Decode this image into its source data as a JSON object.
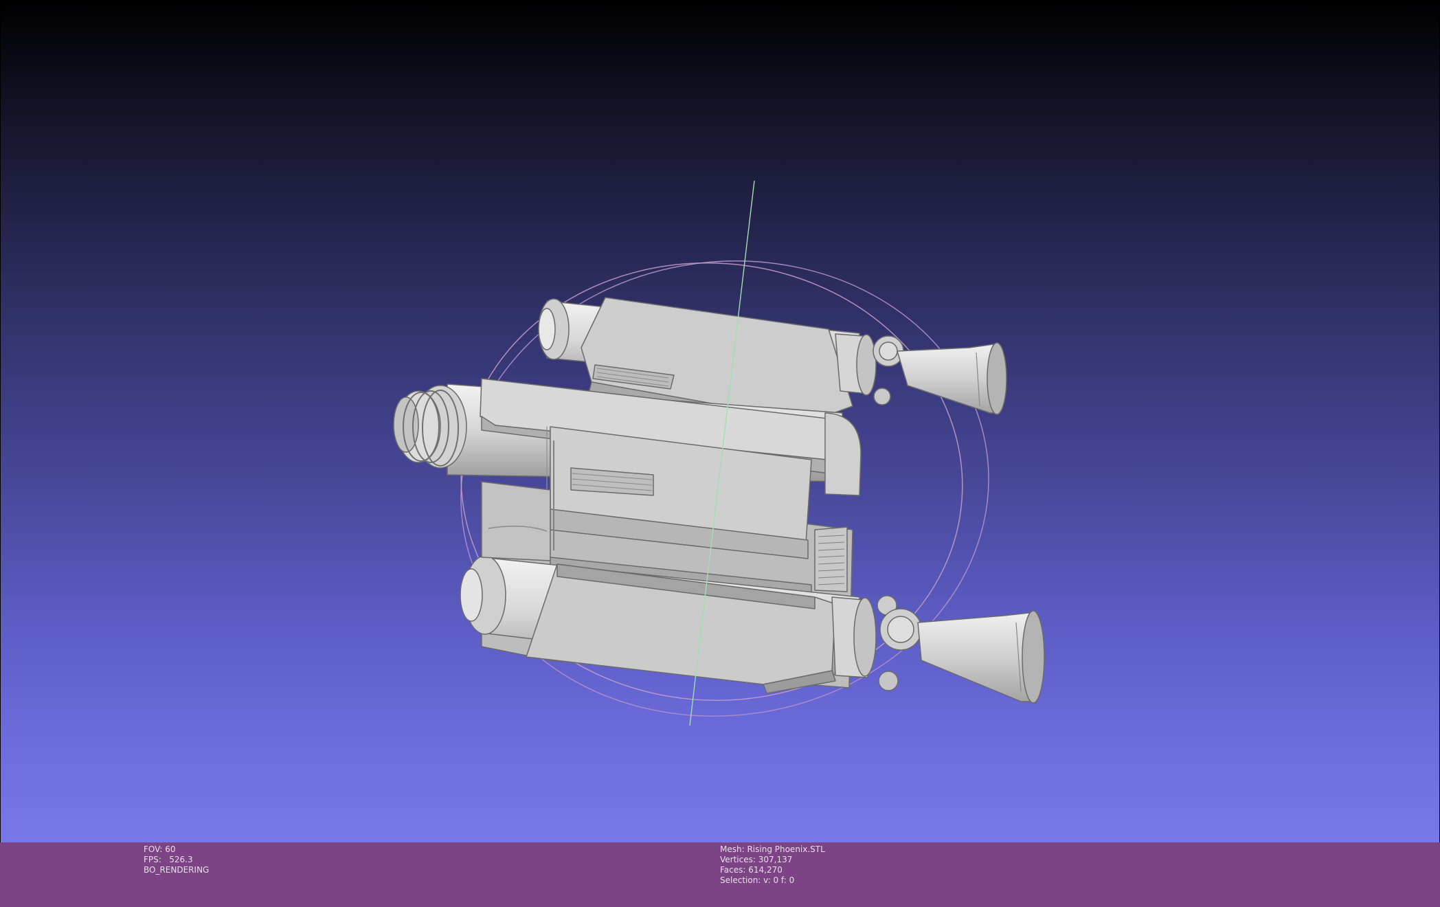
{
  "viewer": {
    "left_info": {
      "fov": "FOV: 60",
      "fps": "FPS:   526.3",
      "render_mode": "BO_RENDERING"
    },
    "mesh_info": {
      "mesh": "Mesh: Rising Phoenix.STL",
      "vertices": "Vertices: 307,137",
      "faces": "Faces: 614,270",
      "selection": "Selection: v: 0 f: 0"
    }
  },
  "colors": {
    "status_bar": "#7c4484",
    "model": "#d4d4d4",
    "trackball_ring": "#c8a0c8",
    "axis_line": "#a0e0b0"
  }
}
